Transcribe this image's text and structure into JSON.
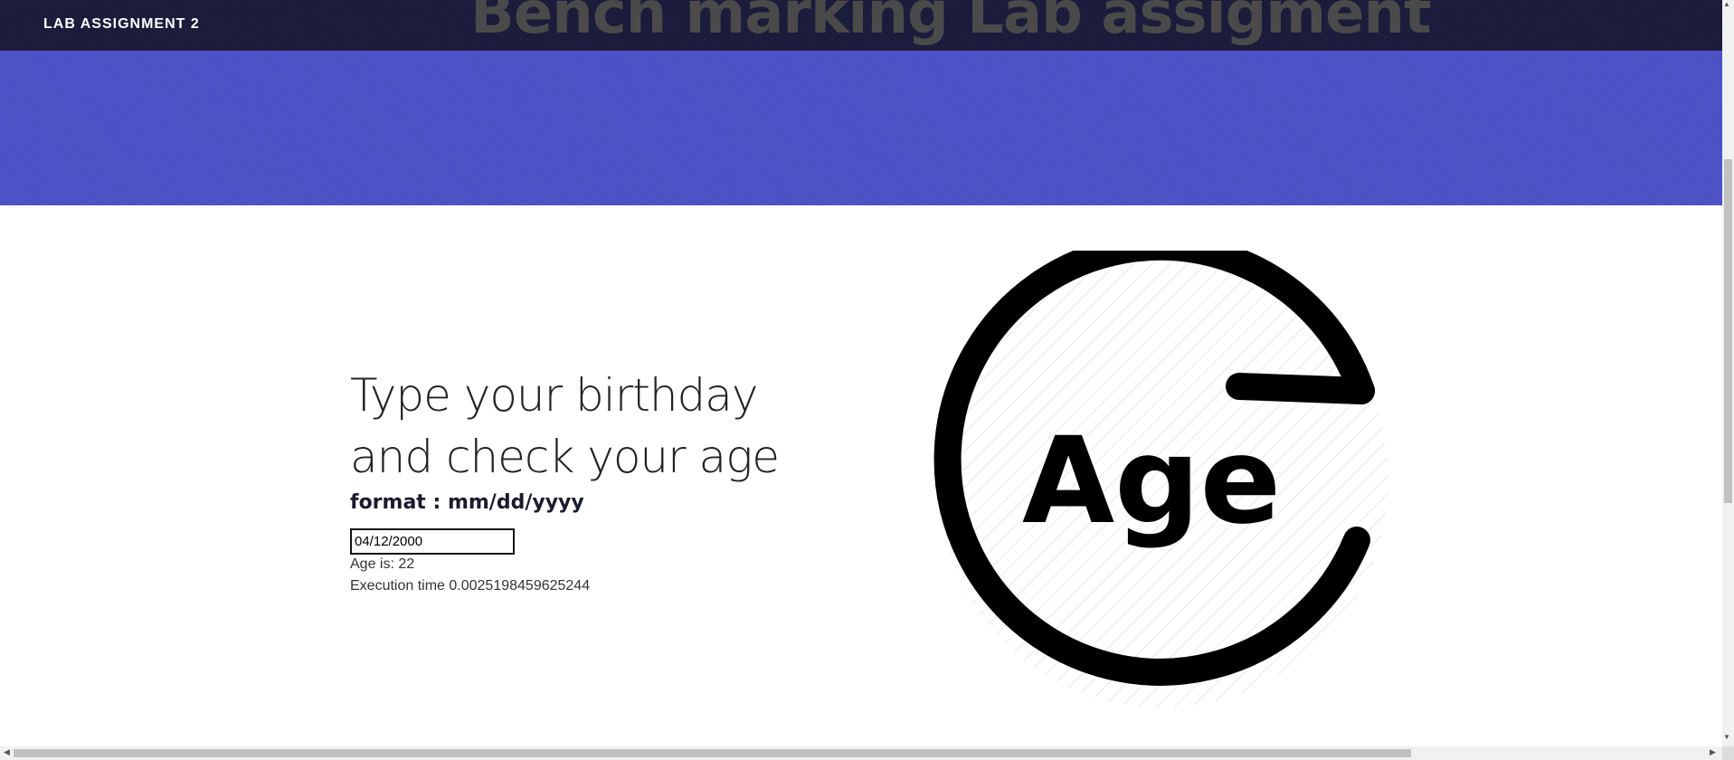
{
  "nav": {
    "title": "LAB ASSIGNMENT 2"
  },
  "hero": {
    "title": "Bench marking Lab assigment"
  },
  "main": {
    "heading_line1": "Type your birthday",
    "heading_line2": "and check your age",
    "format_label": "format : mm/dd/yyyy",
    "birthday_value": "04/12/2000",
    "age_result": "Age is: 22",
    "execution_time": "Execution time 0.0025198459625244"
  },
  "logo": {
    "text": "Age",
    "icon": "age-refresh-icon"
  },
  "colors": {
    "nav_bg": "#1a1a3a",
    "hero_bg": "#4c52c7",
    "hero_title": "#4a4a4a",
    "text": "#222222"
  }
}
